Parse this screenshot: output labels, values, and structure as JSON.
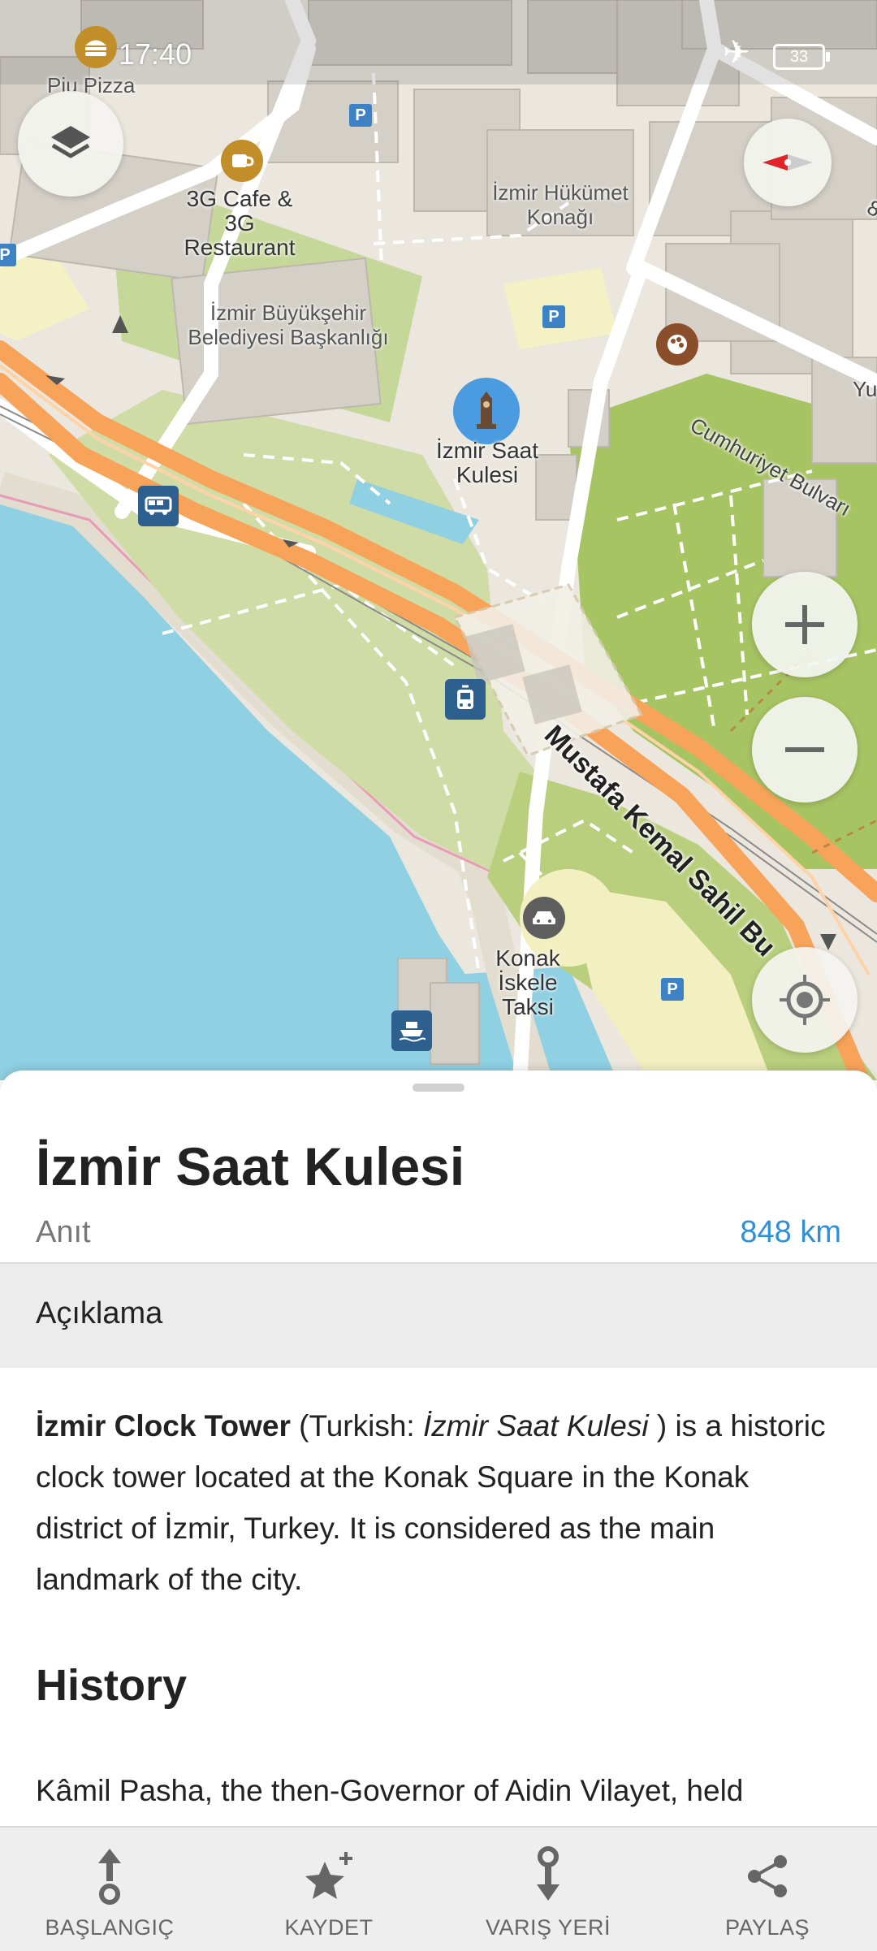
{
  "status_bar": {
    "time": "17:40",
    "battery": "33"
  },
  "map": {
    "labels": {
      "piu_pizza": "Piu Pizza",
      "cafe": "3G Cafe & 3G Restaurant",
      "hukumet": "İzmir Hükümet Konağı",
      "belediye": "İzmir Büyükşehir Belediyesi Başkanlığı",
      "saat_kulesi": "İzmir Saat Kulesi",
      "cumhuriyet": "Cumhuriyet Bulvarı",
      "mustafa": "Mustafa Kemal Sahil Bu",
      "konak_iskele": "Konak İskele Taksi",
      "edge_yu": "Yu",
      "edge_8": "8"
    },
    "parking_symbol": "P",
    "icons": [
      "layers-icon",
      "compass-icon",
      "zoom-in-icon",
      "zoom-out-icon",
      "my-location-icon",
      "burger-icon",
      "coffee-icon",
      "palette-icon",
      "bus-icon",
      "tram-icon",
      "taxi-icon",
      "ferry-icon",
      "clock-tower-icon"
    ]
  },
  "place": {
    "title": "İzmir Saat Kulesi",
    "type": "Anıt",
    "distance": "848 km"
  },
  "section": {
    "description_header": "Açıklama"
  },
  "description": {
    "bold": "İzmir Clock Tower",
    "part1": " (Turkish: ",
    "italic": "İzmir Saat Kulesi",
    "part2": " ) is a historic clock tower located at the Konak Square in the Konak district of İzmir, Turkey. It is considered as the main landmark of the city."
  },
  "history": {
    "heading": "History",
    "text": "Kâmil Pasha, the then-Governor of Aidin Vilayet, held"
  },
  "bottom_bar": {
    "start": "BAŞLANGIÇ",
    "save": "KAYDET",
    "destination": "VARIŞ YERİ",
    "share": "PAYLAŞ"
  }
}
